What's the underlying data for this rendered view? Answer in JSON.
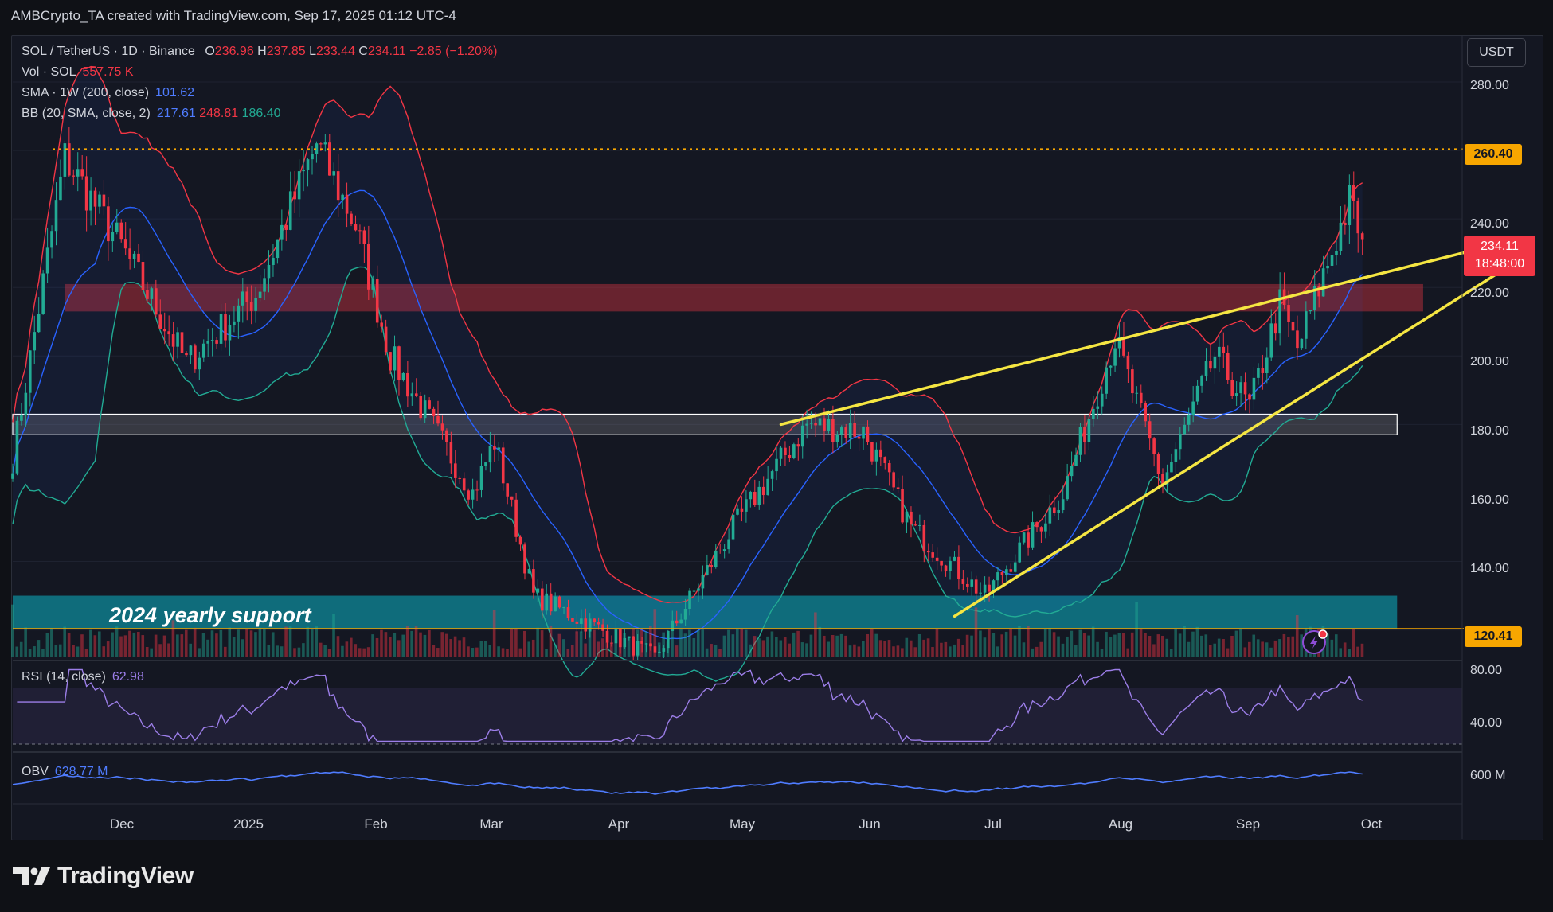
{
  "header": {
    "title": "AMBCrypto_TA created with TradingView.com, Sep 17, 2025 01:12 UTC-4"
  },
  "legend": {
    "symbol": "SOL / TetherUS · 1D · Binance",
    "o_label": "O",
    "o_value": "236.96",
    "h_label": "H",
    "h_value": "237.85",
    "l_label": "L",
    "l_value": "233.44",
    "c_label": "C",
    "c_value": "234.11",
    "change": "−2.85 (−1.20%)",
    "vol_label": "Vol · SOL",
    "vol_value": "557.75 K",
    "sma_label": "SMA · 1W (200, close)",
    "sma_value": "101.62",
    "bb_label": "BB (20, SMA, close, 2)",
    "bb_basis": "217.61",
    "bb_upper": "248.81",
    "bb_lower": "186.40"
  },
  "currency_button": "USDT",
  "price_axis": [
    "280.00",
    "260.40",
    "240.00",
    "234.11",
    "18:48:00",
    "220.00",
    "200.00",
    "180.00",
    "160.00",
    "140.00",
    "120.41"
  ],
  "price_axis_plain": [
    "280.00",
    "240.00",
    "220.00",
    "200.00",
    "180.00",
    "160.00",
    "140.00"
  ],
  "current_price": {
    "price": "234.11",
    "countdown": "18:48:00"
  },
  "resistance_level": "260.40",
  "support_level": "120.41",
  "annotation": "2024 yearly support",
  "rsi": {
    "label": "RSI (14, close)",
    "value": "62.98",
    "axis": [
      "80.00",
      "40.00"
    ]
  },
  "obv": {
    "label": "OBV",
    "value": "628.77 M",
    "axis": [
      "600 M"
    ]
  },
  "x_axis": [
    "Dec",
    "2025",
    "Feb",
    "Mar",
    "Apr",
    "May",
    "Jun",
    "Jul",
    "Aug",
    "Sep",
    "Oct"
  ],
  "brand": "TradingView",
  "colors": {
    "up": "#22ab94",
    "down": "#f23645",
    "bb_upper": "#f23645",
    "bb_basis": "#2962ff",
    "bb_lower": "#22ab94",
    "trendline": "#f5e642",
    "level": "#f7a600",
    "rsi": "#9c7ee8",
    "obv": "#4f7cff"
  },
  "chart_data": {
    "type": "candlestick",
    "x_range": [
      "2024-11-10",
      "2025-10-10"
    ],
    "ylim": [
      112,
      290
    ],
    "key_points": [
      {
        "date": "2024-11-10",
        "price": 170
      },
      {
        "date": "2024-11-22",
        "price": 258
      },
      {
        "date": "2024-12-05",
        "price": 232
      },
      {
        "date": "2024-12-20",
        "price": 198
      },
      {
        "date": "2025-01-05",
        "price": 218
      },
      {
        "date": "2025-01-19",
        "price": 262
      },
      {
        "date": "2025-01-28",
        "price": 238
      },
      {
        "date": "2025-02-05",
        "price": 200
      },
      {
        "date": "2025-02-24",
        "price": 160
      },
      {
        "date": "2025-03-01",
        "price": 175
      },
      {
        "date": "2025-03-10",
        "price": 130
      },
      {
        "date": "2025-04-07",
        "price": 112
      },
      {
        "date": "2025-04-25",
        "price": 150
      },
      {
        "date": "2025-05-12",
        "price": 180
      },
      {
        "date": "2025-05-25",
        "price": 178
      },
      {
        "date": "2025-06-05",
        "price": 150
      },
      {
        "date": "2025-06-22",
        "price": 130
      },
      {
        "date": "2025-07-10",
        "price": 160
      },
      {
        "date": "2025-07-22",
        "price": 205
      },
      {
        "date": "2025-08-02",
        "price": 163
      },
      {
        "date": "2025-08-14",
        "price": 200
      },
      {
        "date": "2025-08-22",
        "price": 185
      },
      {
        "date": "2025-08-29",
        "price": 215
      },
      {
        "date": "2025-09-02",
        "price": 202
      },
      {
        "date": "2025-09-14",
        "price": 245
      },
      {
        "date": "2025-09-17",
        "price": 234.11
      }
    ],
    "zones": [
      {
        "name": "resistance zone",
        "from": 213,
        "to": 221
      },
      {
        "name": "support zone",
        "from": 177,
        "to": 183
      },
      {
        "name": "2024 yearly support",
        "from": 120.41,
        "to": 130
      }
    ],
    "levels": [
      260.4,
      120.41
    ],
    "trendlines": [
      {
        "from": [
          "2025-05-06",
          180
        ],
        "to": [
          "2025-10-13",
          231
        ]
      },
      {
        "from": [
          "2025-06-15",
          124
        ],
        "to": [
          "2025-10-18",
          224
        ]
      }
    ],
    "rsi_ylim": [
      30,
      85
    ],
    "rsi_bands": [
      30,
      70
    ]
  }
}
